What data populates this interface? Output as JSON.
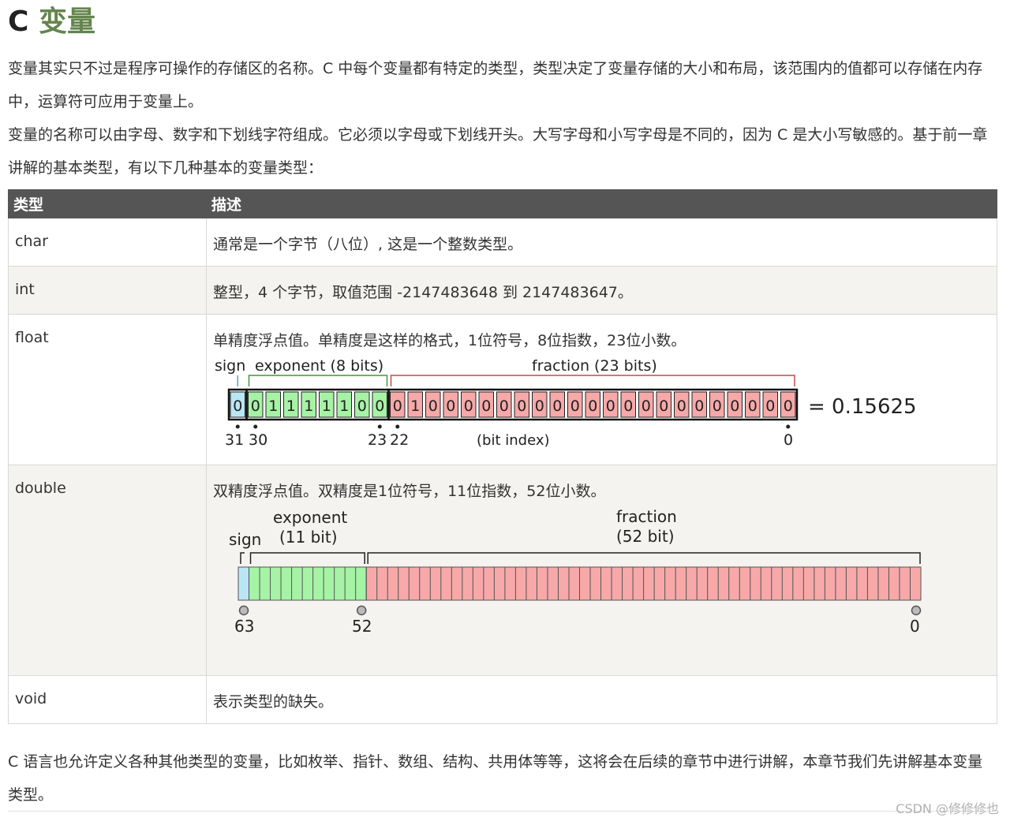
{
  "title": {
    "prefix": "C",
    "main": "变量"
  },
  "paragraphs": {
    "intro": "变量其实只不过是程序可操作的存储区的名称。C 中每个变量都有特定的类型，类型决定了变量存储的大小和布局，该范围内的值都可以存储在内存中，运算符可应用于变量上。",
    "naming": "变量的名称可以由字母、数字和下划线字符组成。它必须以字母或下划线开头。大写字母和小写字母是不同的，因为 C 是大小写敏感的。基于前一章讲解的基本类型，有以下几种基本的变量类型：",
    "outro": "C 语言也允许定义各种其他类型的变量，比如枚举、指针、数组、结构、共用体等等，这将会在后续的章节中进行讲解，本章节我们先讲解基本变量类型。"
  },
  "table": {
    "headers": {
      "type": "类型",
      "description": "描述"
    },
    "rows": [
      {
        "type": "char",
        "description": "通常是一个字节（八位）, 这是一个整数类型。"
      },
      {
        "type": "int",
        "description": "整型，4 个字节，取值范围 -2147483648 到 2147483647。"
      },
      {
        "type": "float",
        "description": "单精度浮点值。单精度是这样的格式，1位符号，8位指数，23位小数。"
      },
      {
        "type": "double",
        "description": "双精度浮点值。双精度是1位符号，11位指数，52位小数。"
      },
      {
        "type": "void",
        "description": "表示类型的缺失。"
      }
    ]
  },
  "float_diagram": {
    "sign_label": "sign",
    "exponent_label": "exponent (8 bits)",
    "fraction_label": "fraction (23 bits)",
    "bits": "00111110001000000000000000000000",
    "result": "= 0.15625",
    "index_labels": {
      "i31": "31",
      "i30": "30",
      "i23": "23",
      "i22": "22",
      "mid": "(bit index)",
      "i0": "0"
    },
    "colors": {
      "sign": "#b9e6f5",
      "exponent": "#a6f3a6",
      "fraction": "#f7a8a8",
      "exp_bracket": "#3a9a3a",
      "frac_bracket": "#c24a4a"
    }
  },
  "double_diagram": {
    "sign_label": "sign",
    "exponent_label_1": "exponent",
    "exponent_label_2": "(11 bit)",
    "fraction_label_1": "fraction",
    "fraction_label_2": "(52 bit)",
    "index_labels": {
      "i63": "63",
      "i52": "52",
      "i0": "0"
    },
    "colors": {
      "sign": "#b9e6f5",
      "exponent": "#a6f3a6",
      "fraction": "#f7a8a8"
    }
  },
  "watermark": "CSDN @修修修也"
}
